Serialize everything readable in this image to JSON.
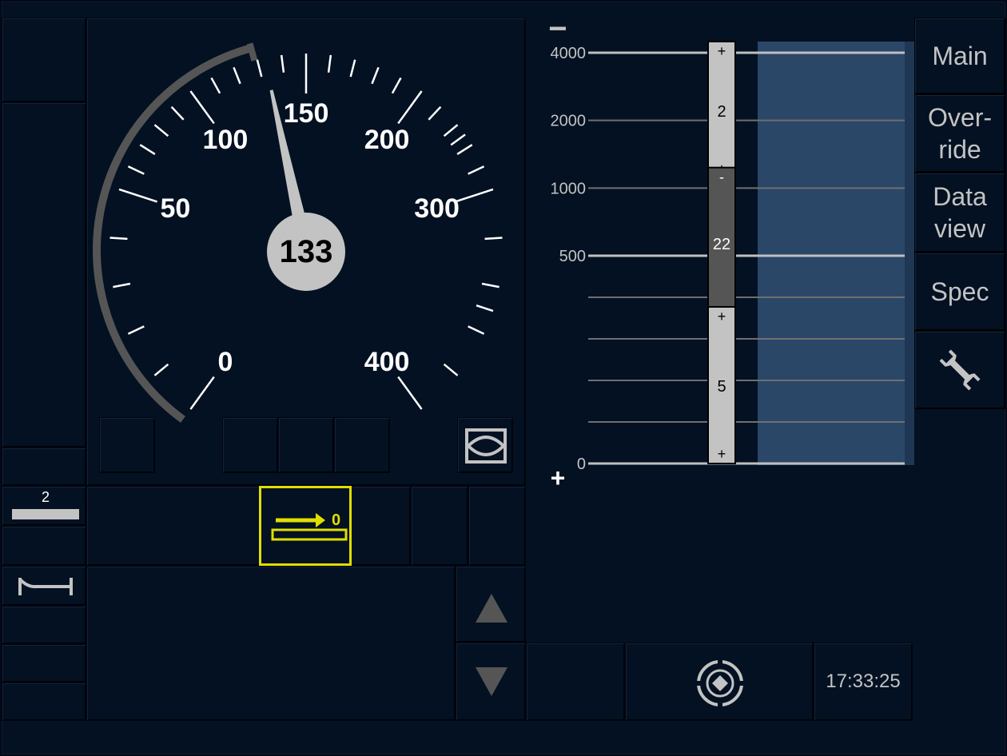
{
  "speedometer": {
    "current_speed": 133,
    "dial_labels": [
      "0",
      "50",
      "100",
      "150",
      "200",
      "300",
      "400"
    ],
    "needle_color": "#c3c3c3",
    "permitted_arc_color": "#555555"
  },
  "planning": {
    "scale_labels": [
      "4000",
      "2000",
      "1000",
      "500",
      "0"
    ],
    "zoom_out_label": "−",
    "zoom_in_label": "+",
    "gradients": [
      {
        "value": "2",
        "top_sign": "+",
        "bottom_sign": "+",
        "color": "#c3c3c3"
      },
      {
        "value": "22",
        "top_sign": "-",
        "bottom_sign": "-",
        "color": "#555555"
      },
      {
        "value": "5",
        "top_sign": "+",
        "bottom_sign": "+",
        "color": "#c3c3c3"
      }
    ],
    "pasp_color": "#2a4768"
  },
  "menu": {
    "main": "Main",
    "override": "Over-\nride",
    "data_view": "Data\nview",
    "spec": "Spec",
    "settings_icon": "wrench-icon"
  },
  "status": {
    "level_badge": "2",
    "level_transition_value": "0",
    "level_transition_color": "#dfdf00",
    "clock": "17:33:25",
    "scroll_up_icon": "triangle-up-icon",
    "scroll_down_icon": "triangle-down-icon",
    "mode_icon": "eye-icon",
    "hourglass_icon": "tunnel-icon",
    "dmi_icon": "target-icon"
  }
}
